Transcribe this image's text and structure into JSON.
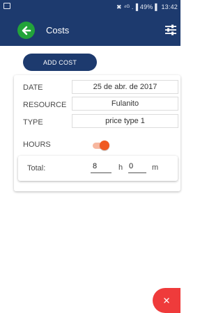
{
  "status_bar": {
    "status_text": "✖ ⁴ᴳ .▐ 49% ▌ 13:42"
  },
  "app_bar": {
    "title": "Costs"
  },
  "actions": {
    "add_cost_label": "ADD COST"
  },
  "form": {
    "date": {
      "label": "DATE",
      "value": "25 de abr. de 2017"
    },
    "resource": {
      "label": "RESOURCE",
      "value": "Fulanito"
    },
    "type": {
      "label": "TYPE",
      "value": "price type 1"
    },
    "hours": {
      "label": "HOURS",
      "toggle_on": true
    }
  },
  "total": {
    "label": "Total:",
    "hours_value": "8",
    "hours_unit": "h",
    "minutes_value": "0",
    "minutes_unit": "m"
  },
  "icons": {
    "back": "arrow-left-icon",
    "filter": "sliders-icon",
    "fab": "close-icon"
  },
  "colors": {
    "primary": "#1d3a6e",
    "back_button": "#22a33a",
    "toggle_accent": "#f05a22",
    "fab": "#ef3b3b"
  }
}
